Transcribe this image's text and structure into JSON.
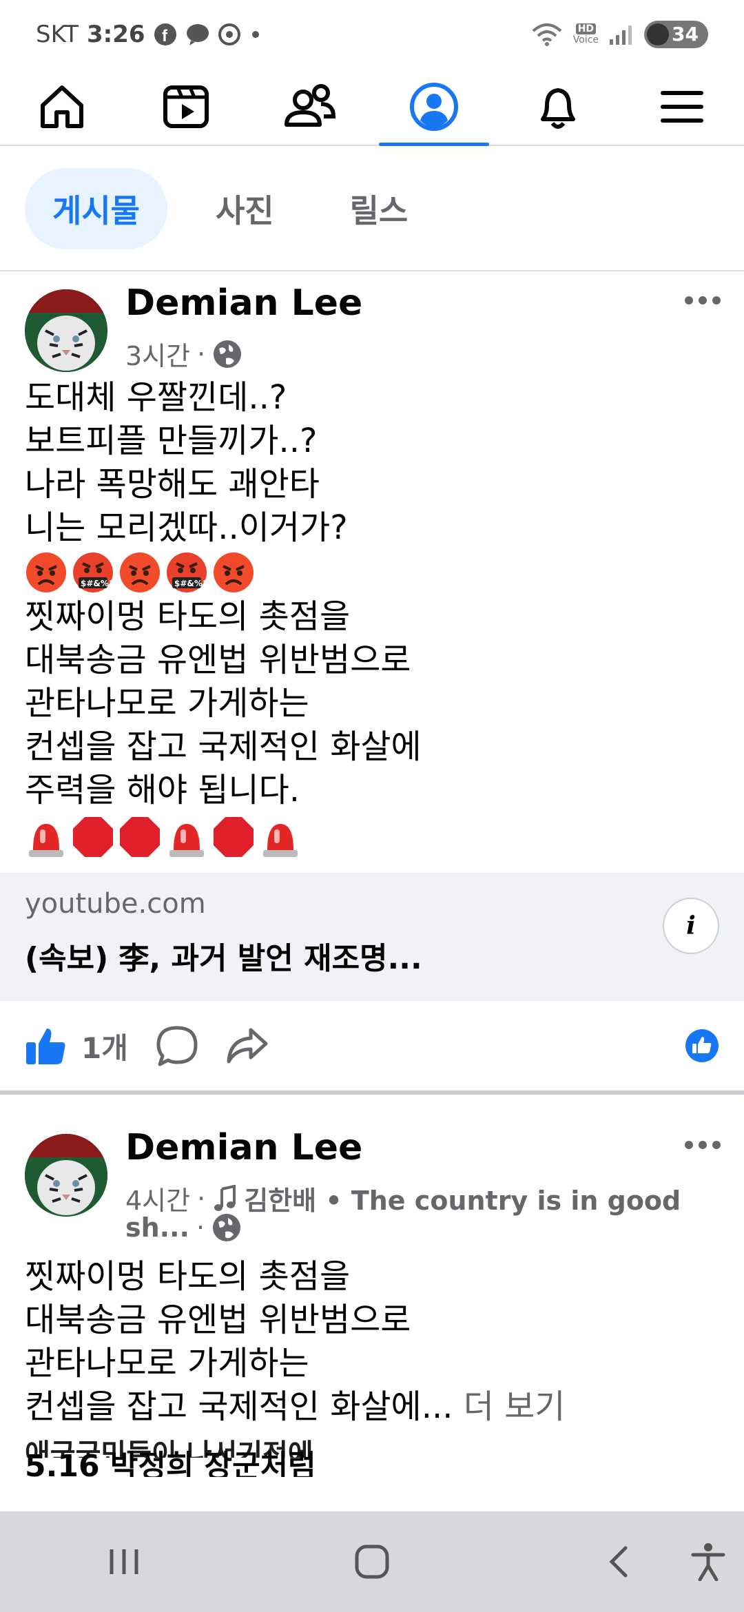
{
  "status": {
    "carrier": "SKT",
    "time": "3:26",
    "battery": "34",
    "hd_label": "HD",
    "voice_label": "Voice"
  },
  "nav": {
    "items": [
      {
        "name": "home-icon"
      },
      {
        "name": "video-icon"
      },
      {
        "name": "friends-icon"
      },
      {
        "name": "profile-icon"
      },
      {
        "name": "bell-icon"
      },
      {
        "name": "menu-icon"
      }
    ],
    "active": "profile-icon"
  },
  "tabs": [
    {
      "label": "게시물"
    },
    {
      "label": "사진"
    },
    {
      "label": "릴스"
    }
  ],
  "posts": [
    {
      "author": "Demian Lee",
      "time": "3시간",
      "lines": [
        "도대체 우짤낀데..?",
        "보트피플 만들끼가..?",
        "나라 폭망해도 괘안타",
        "니는 모리겠따..이거가?"
      ],
      "lines2": [
        "찟짜이멍 타도의 촛점을",
        "대북송금 유엔법 위반범으로",
        "관타나모로 가게하는",
        "컨셉을 잡고 국제적인 화살에",
        "주력을 해야 됩니다."
      ],
      "link": {
        "domain": "youtube.com",
        "title": "(속보) 李, 과거 발언 재조명..."
      },
      "likes": "1개"
    },
    {
      "author": "Demian Lee",
      "time": "4시간",
      "music": "김한배 • The country is in good",
      "music_cont": "sh...",
      "lines": [
        "찟짜이멍 타도의 촛점을",
        "대북송금 유엔법 위반범으로",
        "관타나모로 가게하는",
        "컨셉을 잡고 국제적인 화살에..."
      ],
      "see_more": "더 보기",
      "faded": [
        "애국국민들이 나서기전에...",
        "5.16 박정희 장군처럼"
      ]
    }
  ],
  "colors": {
    "accent": "#1877f2",
    "secondary_text": "#65676b",
    "card_bg": "#f0f2f5"
  }
}
